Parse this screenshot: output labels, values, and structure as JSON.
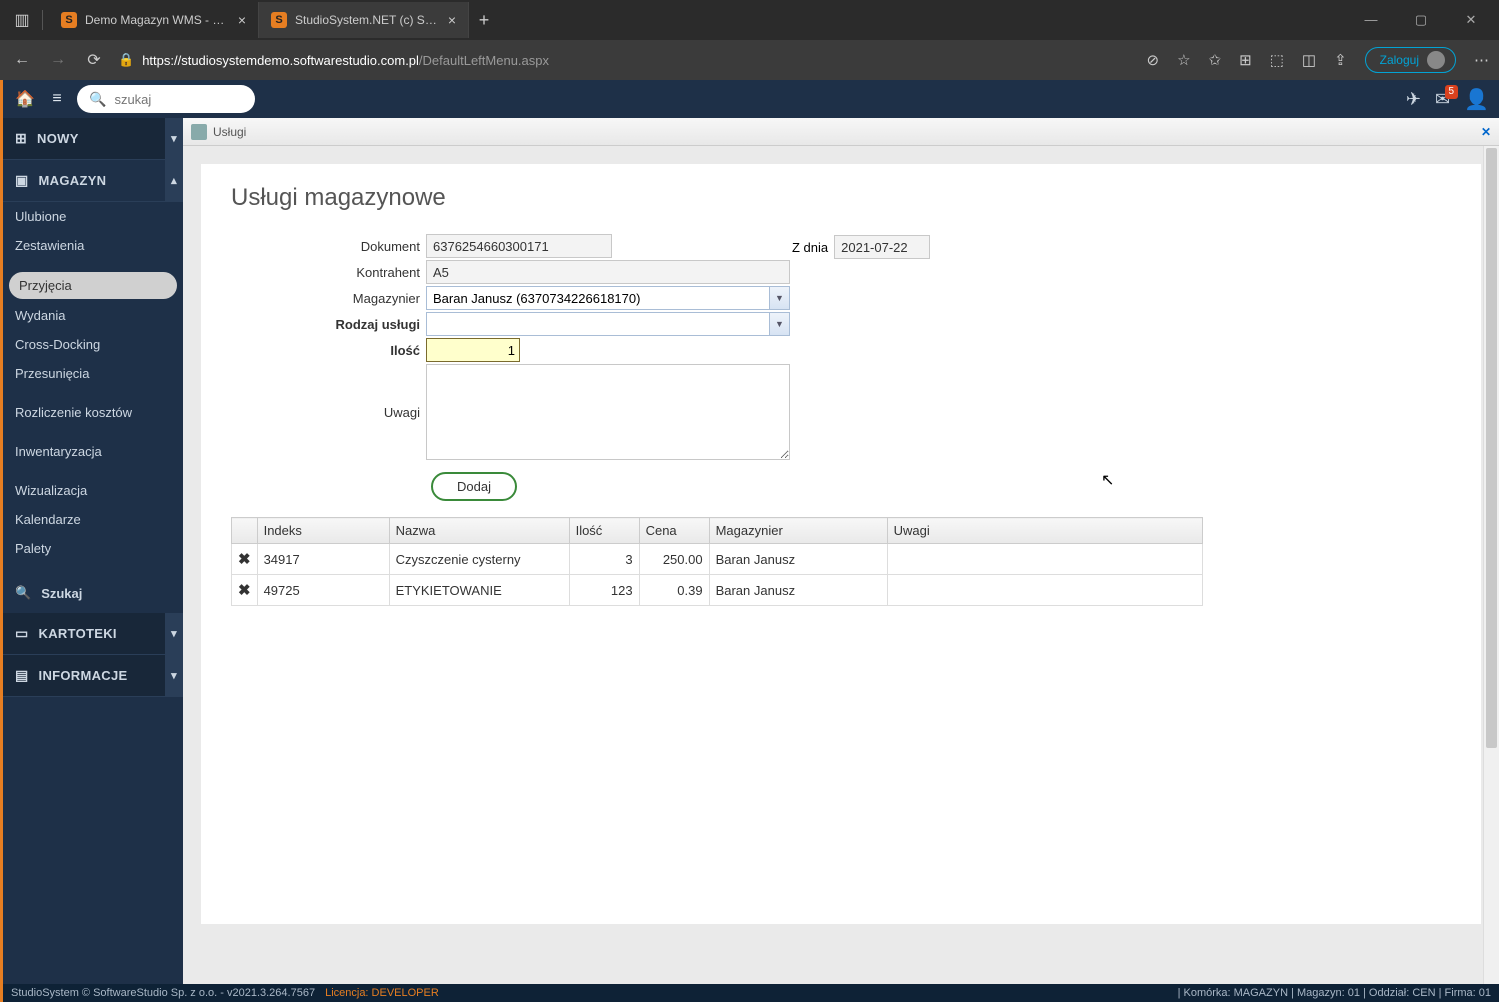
{
  "browser": {
    "tabs": [
      {
        "title": "Demo Magazyn WMS - Demo o",
        "active": false
      },
      {
        "title": "StudioSystem.NET (c) SoftwareSt",
        "active": true
      }
    ],
    "url_host": "https://studiosystemdemo.softwarestudio.com.pl",
    "url_path": "/DefaultLeftMenu.aspx",
    "login_label": "Zaloguj"
  },
  "topbar": {
    "search_placeholder": "szukaj",
    "mail_badge": "5"
  },
  "sidebar": {
    "nowy": "NOWY",
    "magazyn": "MAGAZYN",
    "items_group1": [
      "Ulubione",
      "Zestawienia"
    ],
    "items_group2": [
      "Przyjęcia",
      "Wydania",
      "Cross-Docking",
      "Przesunięcia"
    ],
    "items_group3": [
      "Rozliczenie kosztów"
    ],
    "items_group4": [
      "Inwentaryzacja"
    ],
    "items_group5": [
      "Wizualizacja",
      "Kalendarze",
      "Palety"
    ],
    "szukaj": "Szukaj",
    "kartoteki": "KARTOTEKI",
    "informacje": "INFORMACJE",
    "active_item": "Przyjęcia"
  },
  "content": {
    "tab_title": "Usługi",
    "heading": "Usługi magazynowe",
    "labels": {
      "dokument": "Dokument",
      "zdnia": "Z dnia",
      "kontrahent": "Kontrahent",
      "magazynier": "Magazynier",
      "rodzaj": "Rodzaj usługi",
      "ilosc": "Ilość",
      "uwagi": "Uwagi"
    },
    "values": {
      "dokument": "6376254660300171",
      "zdnia": "2021-07-22",
      "kontrahent": "A5",
      "magazynier": "Baran Janusz (6370734226618170)",
      "rodzaj": "",
      "ilosc": "1",
      "uwagi": ""
    },
    "add_button": "Dodaj",
    "table": {
      "headers": {
        "del": "",
        "indeks": "Indeks",
        "nazwa": "Nazwa",
        "ilosc": "Ilość",
        "cena": "Cena",
        "magazynier": "Magazynier",
        "uwagi": "Uwagi"
      },
      "rows": [
        {
          "indeks": "34917",
          "nazwa": "Czyszczenie cysterny",
          "ilosc": "3",
          "cena": "250.00",
          "magazynier": "Baran Janusz",
          "uwagi": ""
        },
        {
          "indeks": "49725",
          "nazwa": "ETYKIETOWANIE",
          "ilosc": "123",
          "cena": "0.39",
          "magazynier": "Baran Janusz",
          "uwagi": ""
        }
      ]
    }
  },
  "statusbar": {
    "left": "StudioSystem © SoftwareStudio Sp. z o.o. - v2021.3.264.7567",
    "license": "Licencja: DEVELOPER",
    "right": "| Komórka: MAGAZYN | Magazyn: 01 | Oddział: CEN | Firma: 01"
  }
}
